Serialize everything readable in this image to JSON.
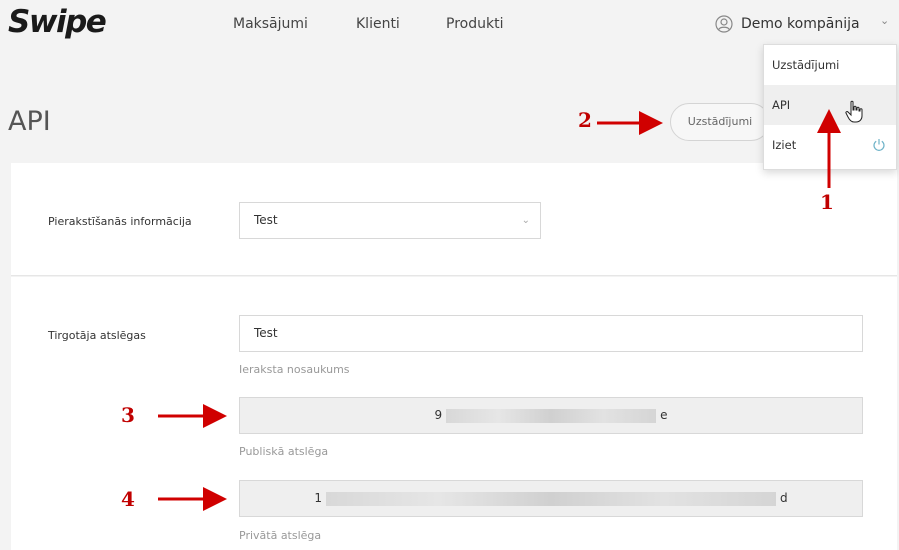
{
  "nav": {
    "logo": "Swipe",
    "links": [
      "Maksājumi",
      "Klienti",
      "Produkti"
    ],
    "company": "Demo kompānija"
  },
  "menu": {
    "items": [
      "Uzstādījumi",
      "API",
      "Iziet"
    ],
    "active": "API"
  },
  "page": {
    "title": "API",
    "settings_button": "Uzstādījumi"
  },
  "login_section": {
    "label": "Pierakstīšanās informācija",
    "selected": "Test"
  },
  "merchant_keys": {
    "label": "Tirgotāja atslēgas",
    "record_name_value": "Test",
    "record_name_hint": "Ieraksta nosaukums",
    "public_key_start": "9",
    "public_key_end": "e",
    "public_key_hint": "Publiskā atslēga",
    "private_key_start": "1",
    "private_key_end": "d",
    "private_key_hint": "Privātā atslēga"
  },
  "annotations": [
    "1",
    "2",
    "3",
    "4"
  ],
  "colors": {
    "annotation": "#d00000",
    "background": "#f3f3f3",
    "panel": "#ffffff"
  }
}
